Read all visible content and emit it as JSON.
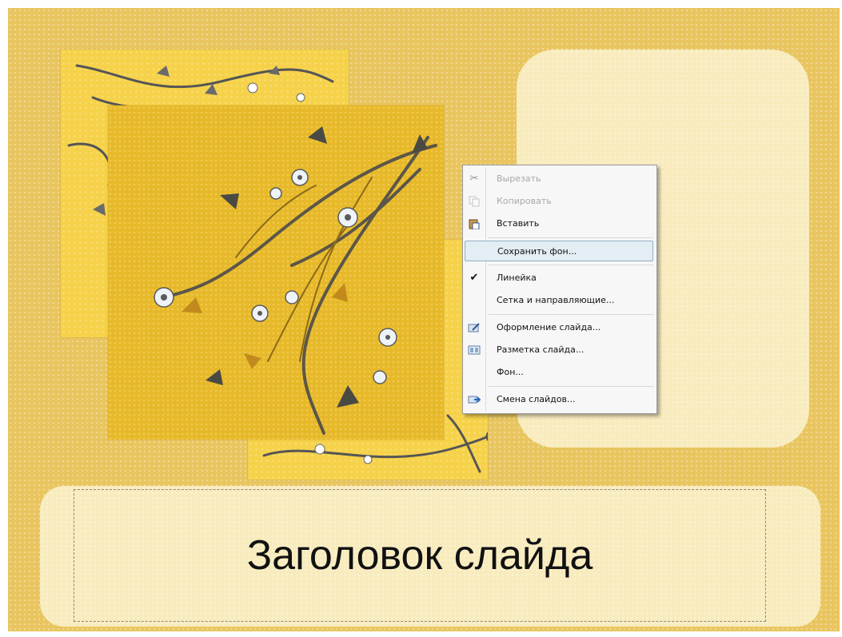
{
  "slide": {
    "title": "Заголовок слайда",
    "background_color": "#e8c55e",
    "placeholder_color": "#f8ebbd"
  },
  "context_menu": {
    "items": [
      {
        "label": "Вырезать",
        "icon": "scissors-icon",
        "enabled": false
      },
      {
        "label": "Копировать",
        "icon": "copy-icon",
        "enabled": false
      },
      {
        "label": "Вставить",
        "icon": "paste-icon",
        "enabled": true
      },
      {
        "label": "Сохранить фон...",
        "icon": "",
        "enabled": true,
        "highlighted": true
      },
      {
        "label": "Линейка",
        "icon": "checkmark-icon",
        "enabled": true,
        "checked": true
      },
      {
        "label": "Сетка и направляющие...",
        "icon": "",
        "enabled": true
      },
      {
        "label": "Оформление слайда...",
        "icon": "slide-design-icon",
        "enabled": true
      },
      {
        "label": "Разметка слайда...",
        "icon": "slide-layout-icon",
        "enabled": true
      },
      {
        "label": "Фон...",
        "icon": "",
        "enabled": true
      },
      {
        "label": "Смена слайдов...",
        "icon": "slide-transition-icon",
        "enabled": true
      }
    ],
    "highlight_color": "#e3edf4"
  }
}
